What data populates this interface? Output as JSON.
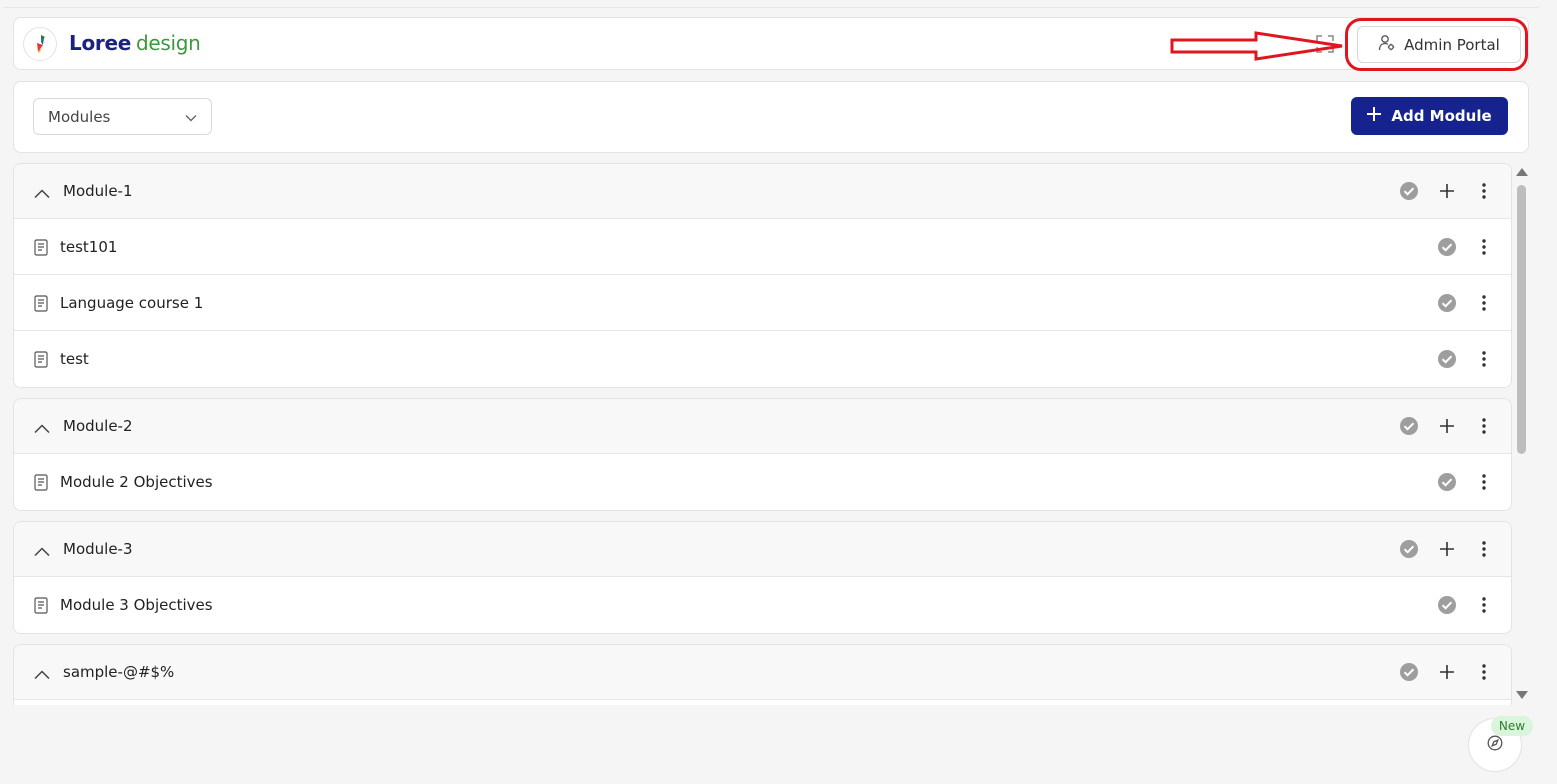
{
  "header": {
    "brand_primary": "Loree",
    "brand_secondary": "design",
    "admin_portal_label": "Admin Portal"
  },
  "toolbar": {
    "select_value": "Modules",
    "add_module_label": "Add Module"
  },
  "modules": [
    {
      "title": "Module-1",
      "items": [
        "test101",
        "Language course 1",
        "test"
      ]
    },
    {
      "title": "Module-2",
      "items": [
        "Module 2 Objectives"
      ]
    },
    {
      "title": "Module-3",
      "items": [
        "Module 3 Objectives"
      ]
    },
    {
      "title": "sample-@#$%",
      "items": []
    }
  ],
  "badge": {
    "new_label": "New"
  },
  "colors": {
    "brand_blue": "#1a237e",
    "brand_green": "#3a9a3a",
    "primary_button": "#16238f",
    "annotation_red": "#e0161e"
  }
}
